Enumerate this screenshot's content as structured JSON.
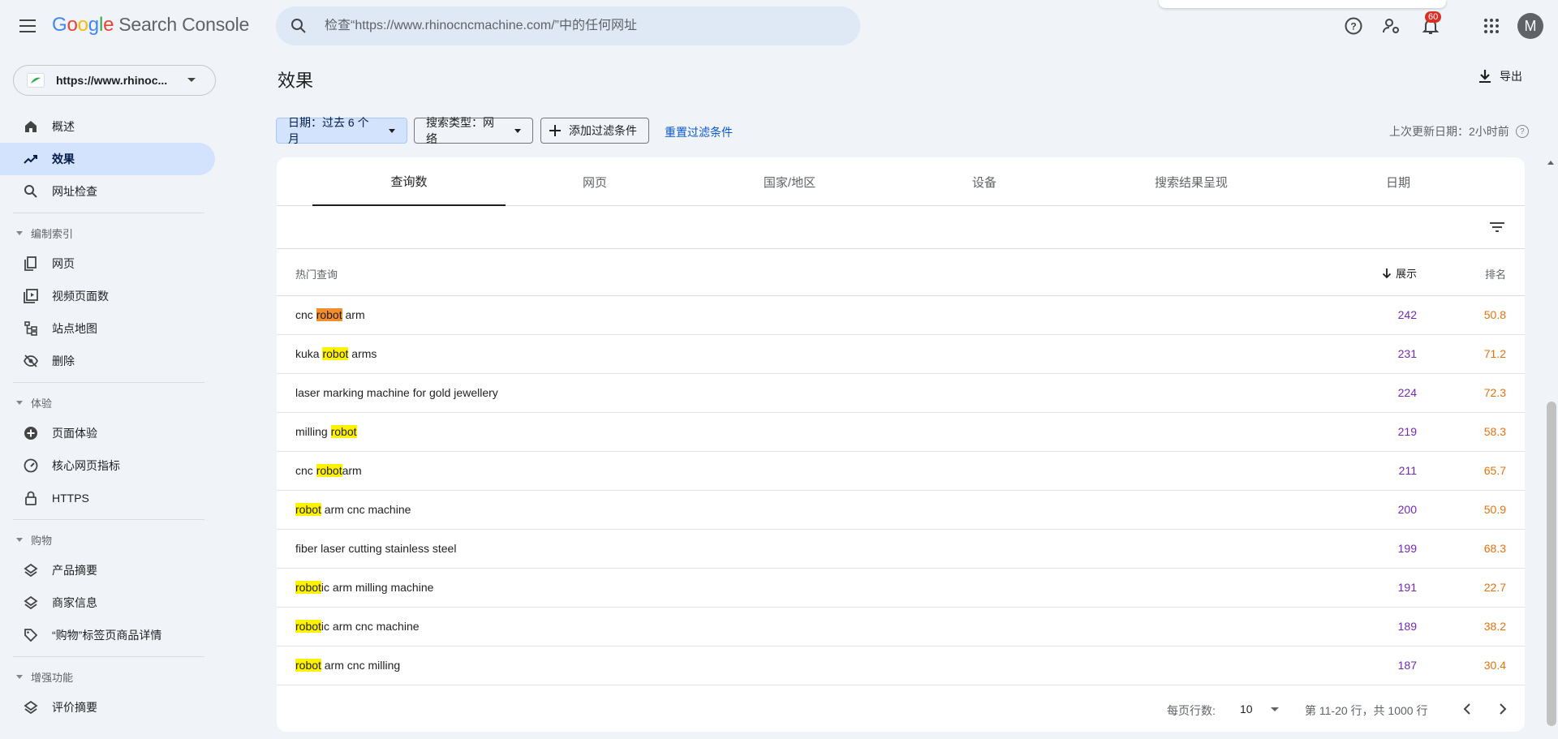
{
  "header": {
    "logo_google": [
      "G",
      "o",
      "o",
      "g",
      "l",
      "e"
    ],
    "logo_product": "Search Console",
    "search_placeholder": "检查“https://www.rhinocncmachine.com/”中的任何网址",
    "notification_count": "60",
    "avatar_letter": "M"
  },
  "property": {
    "url": "https://www.rhinoc..."
  },
  "sidebar": {
    "items_top": [
      {
        "label": "概述",
        "icon": "home-icon"
      },
      {
        "label": "效果",
        "icon": "trending-up-icon",
        "active": true
      },
      {
        "label": "网址检查",
        "icon": "search-icon"
      }
    ],
    "sections": [
      {
        "title": "编制索引",
        "items": [
          {
            "label": "网页",
            "icon": "pages-icon"
          },
          {
            "label": "视频页面数",
            "icon": "video-icon"
          },
          {
            "label": "站点地图",
            "icon": "sitemap-icon"
          },
          {
            "label": "删除",
            "icon": "hidden-icon"
          }
        ]
      },
      {
        "title": "体验",
        "items": [
          {
            "label": "页面体验",
            "icon": "plus-circle-icon"
          },
          {
            "label": "核心网页指标",
            "icon": "speed-icon"
          },
          {
            "label": "HTTPS",
            "icon": "lock-icon"
          }
        ]
      },
      {
        "title": "购物",
        "items": [
          {
            "label": "产品摘要",
            "icon": "layers-icon"
          },
          {
            "label": "商家信息",
            "icon": "layers-icon"
          },
          {
            "label": "“购物”标签页商品详情",
            "icon": "tag-icon"
          }
        ]
      },
      {
        "title": "增强功能",
        "items": [
          {
            "label": "评价摘要",
            "icon": "layers-icon"
          }
        ]
      }
    ]
  },
  "main": {
    "title": "效果",
    "export_label": "导出",
    "filters": {
      "date": "日期：过去 6 个月",
      "search_type": "搜索类型：网络",
      "add_filter": "添加过滤条件",
      "reset": "重置过滤条件"
    },
    "last_updated": "上次更新日期：2小时前",
    "tabs": [
      "查询数",
      "网页",
      "国家/地区",
      "设备",
      "搜索结果呈现",
      "日期"
    ],
    "table": {
      "headers": {
        "query": "热门查询",
        "impressions": "展示",
        "position": "排名"
      },
      "rows": [
        {
          "query": "cnc robot arm",
          "impressions": "242",
          "position": "50.8"
        },
        {
          "query": "kuka robot arms",
          "impressions": "231",
          "position": "71.2"
        },
        {
          "query": "laser marking machine for gold jewellery",
          "impressions": "224",
          "position": "72.3"
        },
        {
          "query": "milling robot",
          "impressions": "219",
          "position": "58.3"
        },
        {
          "query": "cnc robotarm",
          "impressions": "211",
          "position": "65.7"
        },
        {
          "query": "robot arm cnc machine",
          "impressions": "200",
          "position": "50.9"
        },
        {
          "query": "fiber laser cutting stainless steel",
          "impressions": "199",
          "position": "68.3"
        },
        {
          "query": "robotic arm milling machine",
          "impressions": "191",
          "position": "22.7"
        },
        {
          "query": "robotic arm cnc machine",
          "impressions": "189",
          "position": "38.2"
        },
        {
          "query": "robot arm cnc milling",
          "impressions": "187",
          "position": "30.4"
        }
      ],
      "highlight_term": "robot"
    },
    "pager": {
      "rows_label": "每页行数:",
      "rows_value": "10",
      "range": "第 11-20 行，共 1000 行"
    }
  },
  "colors": {
    "impressions": "#7627bb",
    "position": "#e8710a",
    "highlight": "#fff200",
    "active_highlight": "#f28e2b",
    "accent": "#0b57d0"
  }
}
